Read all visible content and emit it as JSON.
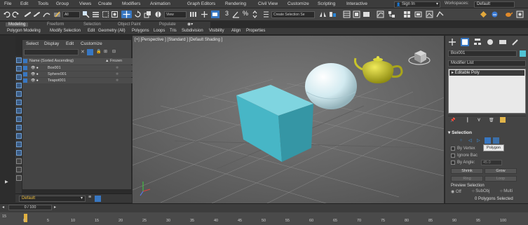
{
  "menu": {
    "items": [
      "File",
      "Edit",
      "Tools",
      "Group",
      "Views",
      "Create",
      "Modifiers",
      "Animation",
      "Graph Editors",
      "Rendering",
      "Civil View",
      "Customize",
      "Scripting",
      "Interactive"
    ],
    "sign_in": "Sign In",
    "workspaces_label": "Workspaces:",
    "workspace_value": "Default"
  },
  "toolbar": {
    "selection_filter": "All",
    "reference_coord": "View",
    "selection_set": "Create Selection Se",
    "snap_label": "3",
    "percent_label": "%"
  },
  "ribbon": {
    "tabs": [
      "Modeling",
      "Freeform",
      "Selection",
      "Object Paint",
      "Populate"
    ],
    "active_tab": "Modeling",
    "items": [
      "Polygon Modeling",
      "Modify Selection",
      "Edit",
      "Geometry (All)",
      "Polygons",
      "Loops",
      "Tris",
      "Subdivision",
      "Visibility",
      "Align",
      "Properties"
    ]
  },
  "explorer": {
    "menu": [
      "Select",
      "Display",
      "Edit",
      "Customize"
    ],
    "header_name": "Name (Sorted Ascending)",
    "header_frozen": "▲ Frozen",
    "objects": [
      {
        "name": "Box001"
      },
      {
        "name": "Sphere001"
      },
      {
        "name": "Teapot001"
      }
    ],
    "layer": "Default"
  },
  "viewport": {
    "label": "[+] [Perspective ] [Standard ] [Default Shading ]",
    "colors": {
      "box": "#4fbccc",
      "sphere": "#d8eef3",
      "teapot": "#b7b51c",
      "background": "#6b6b6b",
      "grid": "#7c7c7c"
    }
  },
  "command_panel": {
    "object_name": "Box001",
    "object_color": "#4fc2d3",
    "modifier_list": "Modifier List",
    "stack_item": "Editable Poly",
    "selection_title": "Selection",
    "tooltip": "Polygon",
    "by_vertex": "By Vertex",
    "ignore_backfacing": "Ignore Bac",
    "by_angle": "By Angle:",
    "angle_value": "45.0",
    "shrink": "Shrink",
    "grow": "Grow",
    "ring": "Ring",
    "loop": "Loop",
    "preview_selection": "Preview Selection",
    "preview_off": "Off",
    "preview_subobj": "SubObj",
    "preview_multi": "Multi",
    "status": "0 Polygons Selected"
  },
  "timeline": {
    "frame_display": "0 / 100",
    "ticks": [
      "0",
      "5",
      "10",
      "15",
      "20",
      "25",
      "30",
      "35",
      "40",
      "45",
      "50",
      "55",
      "60",
      "65",
      "70",
      "75",
      "80",
      "85",
      "90",
      "95",
      "100"
    ],
    "left_label": "15"
  }
}
